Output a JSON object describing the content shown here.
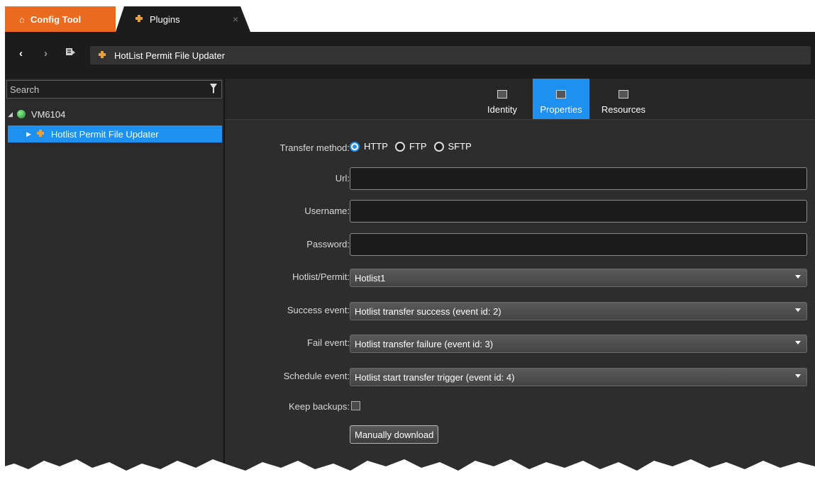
{
  "tabs": {
    "home_label": "Config Tool",
    "plugins_label": "Plugins",
    "close_glyph": "×"
  },
  "nav": {
    "back_glyph": "‹",
    "forward_glyph": "›",
    "address": "HotList Permit File Updater"
  },
  "sidebar": {
    "search_placeholder": "Search",
    "root_label": "VM6104",
    "selected_item": "Hotlist Permit File Updater"
  },
  "view_tabs": [
    {
      "label": "Identity",
      "icon": "identity-icon"
    },
    {
      "label": "Properties",
      "icon": "properties-icon",
      "active": true
    },
    {
      "label": "Resources",
      "icon": "resources-icon"
    }
  ],
  "form": {
    "transfer_method_label": "Transfer method:",
    "transfer_options": [
      "HTTP",
      "FTP",
      "SFTP"
    ],
    "transfer_selected": "HTTP",
    "url_label": "Url:",
    "url_value": "",
    "username_label": "Username:",
    "username_value": "",
    "password_label": "Password:",
    "password_value": "",
    "hotlist_label": "Hotlist/Permit:",
    "hotlist_value": "Hotlist1",
    "success_label": "Success event:",
    "success_value": "Hotlist transfer success (event id: 2)",
    "fail_label": "Fail event:",
    "fail_value": "Hotlist transfer failure (event id: 3)",
    "schedule_label": "Schedule event:",
    "schedule_value": "Hotlist start transfer trigger (event id: 4)",
    "backups_label": "Keep backups:",
    "backups_checked": false,
    "download_button": "Manually download"
  },
  "colors": {
    "accent": "#1e90f0",
    "home_tab": "#ea6b1f",
    "background": "#2d2d2d"
  }
}
